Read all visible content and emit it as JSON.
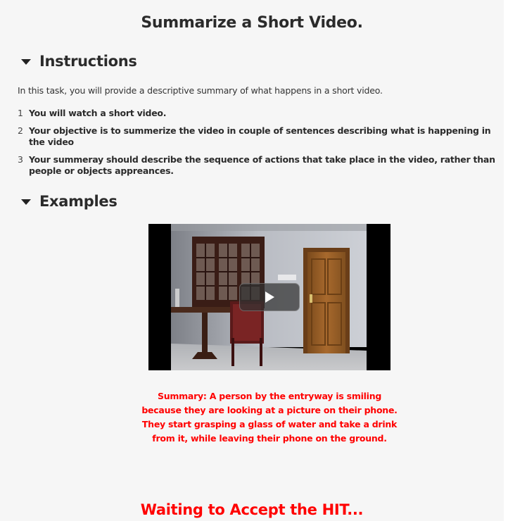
{
  "page": {
    "title": "Summarize a Short Video."
  },
  "instructions": {
    "header": "Instructions",
    "intro": "In this task, you will provide a descriptive summary of what happens in a short video.",
    "steps": [
      {
        "num": "1",
        "text": "You will watch a short video."
      },
      {
        "num": "2",
        "text": "Your objective is to summerize the video in couple of sentences describing what is happening in the video"
      },
      {
        "num": "3",
        "text": "Your summeray should describe the sequence of actions that take place in the video, rather than people or objects appreances."
      }
    ]
  },
  "examples": {
    "header": "Examples",
    "video": {
      "play_icon": "play-icon"
    },
    "summary": "Summary: A person by the entryway is smiling because they are looking at a picture on their phone. They start grasping a glass of water and take a drink from it, while leaving their phone on the ground."
  },
  "status": {
    "waiting": "Waiting to Accept the HIT..."
  },
  "colors": {
    "accent_red": "#ff0000",
    "page_bg": "#f6f6f6"
  }
}
